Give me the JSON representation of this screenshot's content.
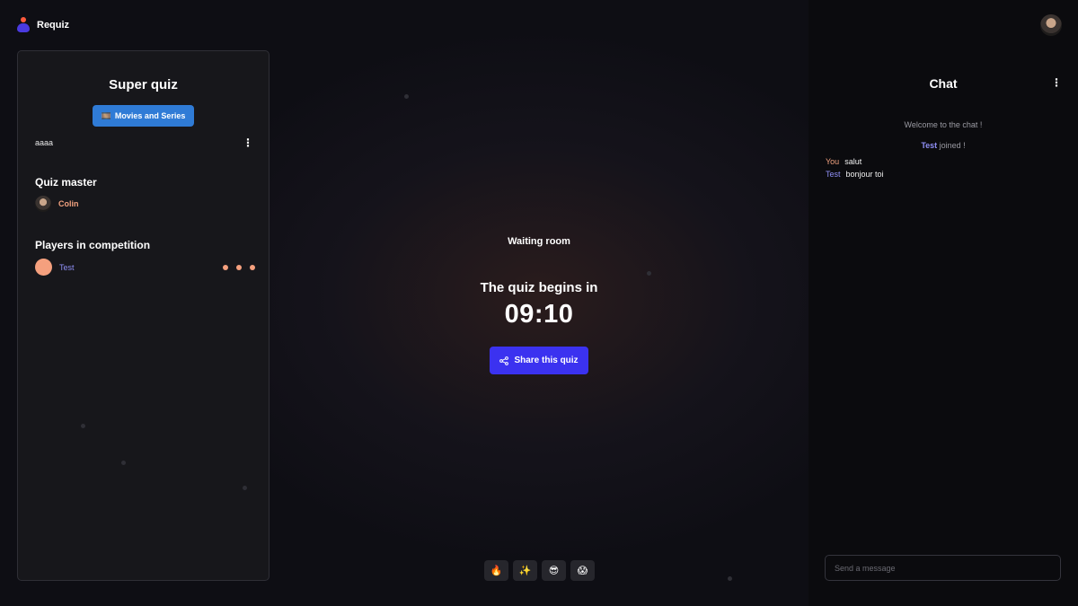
{
  "app": {
    "name": "Requiz"
  },
  "quiz": {
    "title": "Super quiz",
    "category_icon": "🎞️",
    "category": "Movies and Series",
    "description": "aaaa",
    "quiz_master_heading": "Quiz master",
    "quiz_master": "Colin",
    "players_heading": "Players in competition",
    "players": [
      {
        "name": "Test",
        "avatar_color": "#f5a07e"
      }
    ]
  },
  "waiting_room": {
    "heading": "Waiting room",
    "begins_label": "The quiz begins in",
    "countdown": "09:10",
    "share_label": "Share this quiz"
  },
  "reactions": [
    "🔥",
    "✨",
    "😎",
    "😱"
  ],
  "chat": {
    "title": "Chat",
    "welcome": "Welcome to the chat !",
    "joined_name": "Test",
    "joined_suffix": " joined !",
    "messages": [
      {
        "author": "You",
        "text": "salut"
      },
      {
        "author": "Test",
        "text": "bonjour toi"
      }
    ],
    "input_placeholder": "Send a message"
  },
  "colors": {
    "accent": "#3b32f0",
    "category": "#2f7bd6",
    "player": "#f5a07e",
    "link_name": "#8f8ff5"
  }
}
